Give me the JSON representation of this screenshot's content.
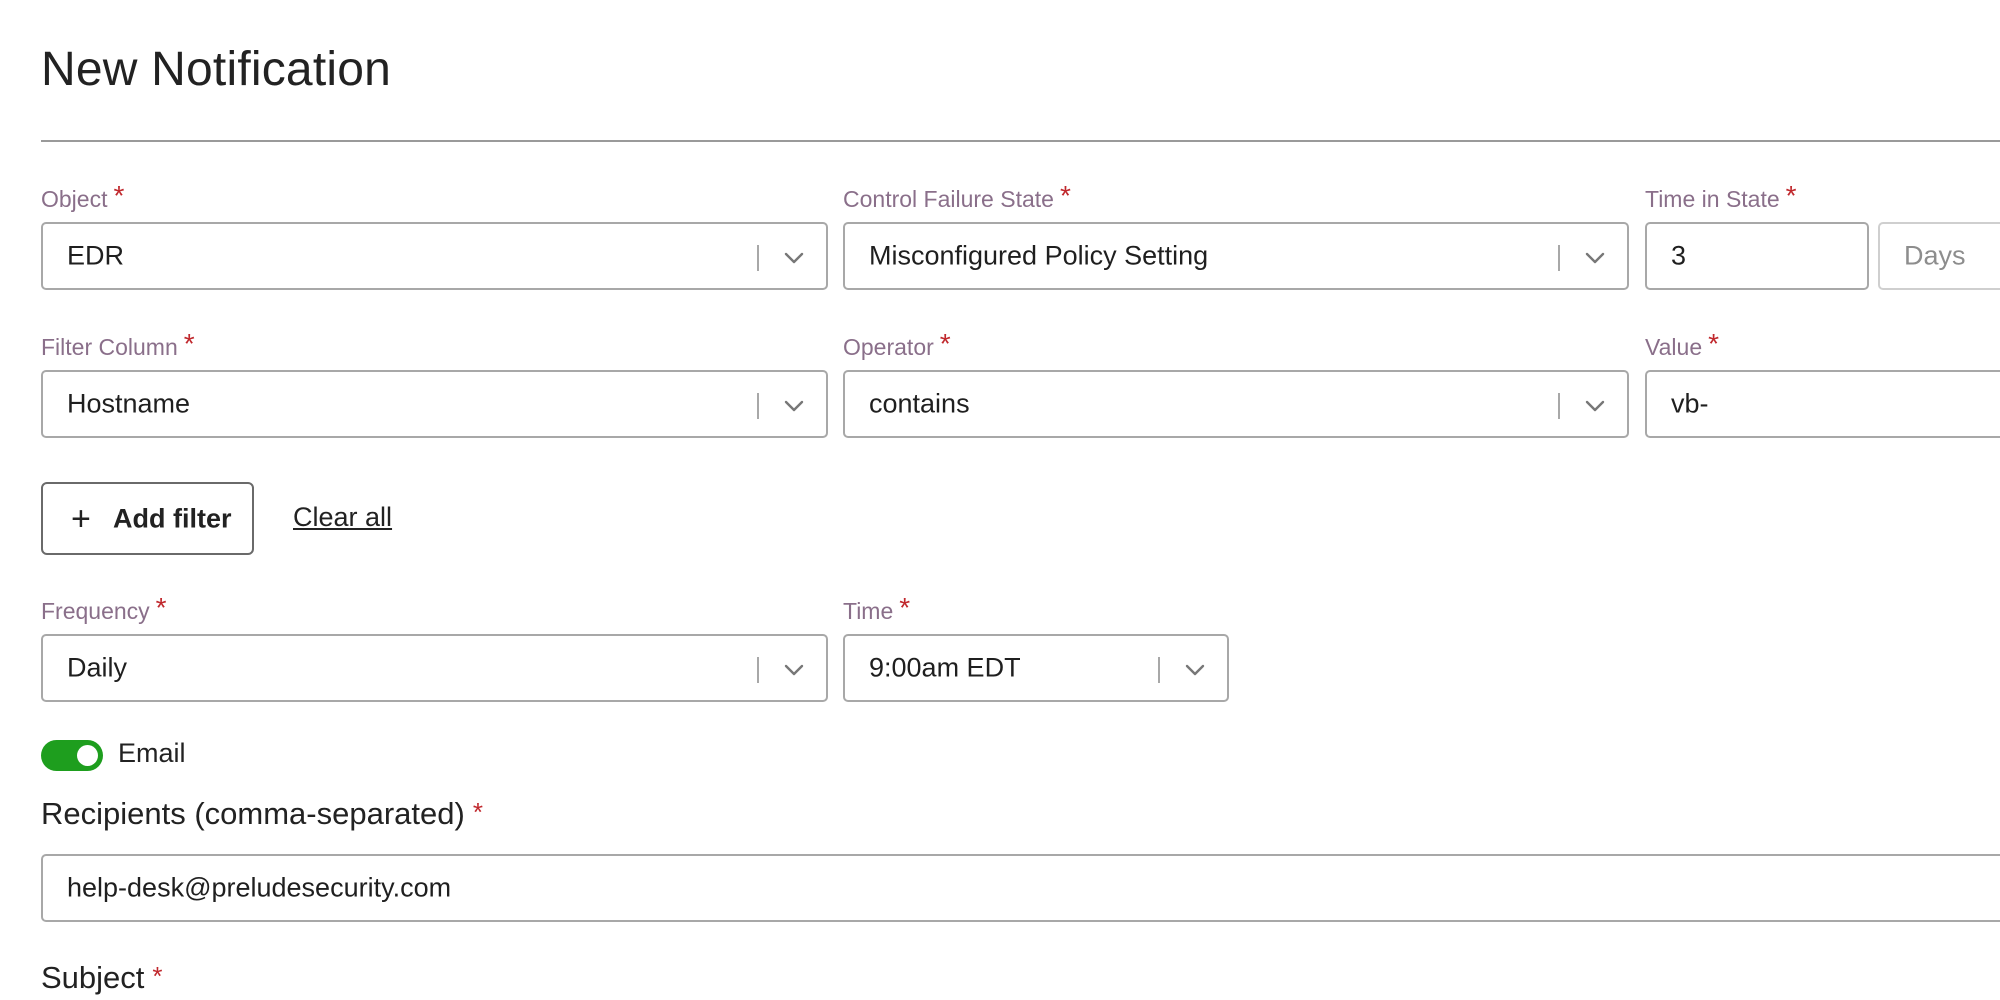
{
  "page": {
    "title": "New Notification"
  },
  "required_mark": "*",
  "object": {
    "label": "Object",
    "value": "EDR"
  },
  "control_failure_state": {
    "label": "Control Failure State",
    "value": "Misconfigured Policy Setting"
  },
  "time_in_state": {
    "label": "Time in State",
    "value": "3",
    "unit_placeholder": "Days"
  },
  "filter_column": {
    "label": "Filter Column",
    "value": "Hostname"
  },
  "operator": {
    "label": "Operator",
    "value": "contains"
  },
  "value_field": {
    "label": "Value",
    "value": "vb-"
  },
  "actions": {
    "add_filter": "Add filter",
    "add_icon": "+",
    "clear_all": "Clear all"
  },
  "frequency": {
    "label": "Frequency",
    "value": "Daily"
  },
  "time": {
    "label": "Time",
    "value": "9:00am EDT"
  },
  "email_toggle": {
    "label": "Email",
    "on": true,
    "on_color": "#1e9e1e"
  },
  "recipients": {
    "label": "Recipients (comma-separated)",
    "value": "help-desk@preludesecurity.com"
  },
  "subject": {
    "label": "Subject"
  }
}
